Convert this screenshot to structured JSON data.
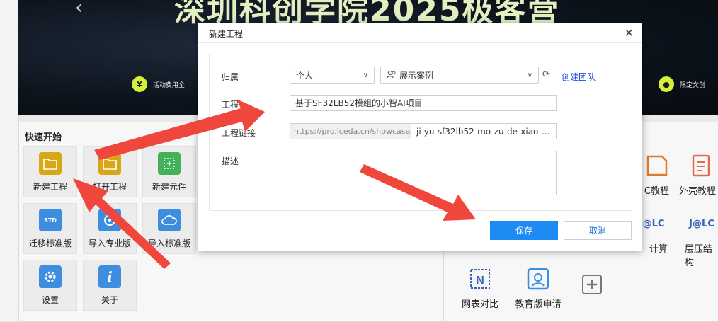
{
  "banner": {
    "title": "深圳科创学院2025极客营",
    "pill_left": "活动费用全",
    "pill_right": "限定文创"
  },
  "quick_start": {
    "title": "快速开始",
    "tiles": [
      {
        "label": "新建工程",
        "icon": "new-project-folder-icon",
        "color": "#d9a715"
      },
      {
        "label": "打开工程",
        "icon": "open-project-folder-icon",
        "color": "#d9a715"
      },
      {
        "label": "新建元件",
        "icon": "new-component-icon",
        "color": "#43b15a"
      },
      {
        "label": "迁移标准版",
        "icon": "migrate-std-icon",
        "color": "#3e8ee0"
      },
      {
        "label": "导入专业版",
        "icon": "import-pro-icon",
        "color": "#3e8ee0"
      },
      {
        "label": "导入标准版",
        "icon": "import-std-icon",
        "color": "#3e8ee0"
      },
      {
        "label": "设置",
        "icon": "settings-gear-icon",
        "color": "#3e8ee0"
      },
      {
        "label": "关于",
        "icon": "info-icon",
        "color": "#3e8ee0"
      }
    ]
  },
  "right_panel": {
    "tiles": [
      {
        "label": "C教程",
        "icon": "fpc-tutorial-icon"
      },
      {
        "label": "外壳教程",
        "icon": "enclosure-tutorial-icon"
      },
      {
        "label": "计算",
        "icon": "jlc-calculator-icon"
      },
      {
        "label": "层压结构",
        "icon": "jlc-stackup-icon"
      },
      {
        "label": "网表对比",
        "icon": "netlist-compare-icon"
      },
      {
        "label": "教育版申请",
        "icon": "education-apply-icon"
      },
      {
        "label": "",
        "icon": "add-plus-icon"
      }
    ]
  },
  "dialog": {
    "title": "新建工程",
    "belong_label": "归属",
    "owner_value": "个人",
    "team_value": "展示案例",
    "create_team_link": "创建团队",
    "project_label": "工程",
    "project_value": "基于SF32LB52模组的小智AI项目",
    "link_label": "工程链接",
    "link_prefix": "https://pro.lceda.cn/showcase/",
    "link_slug": "ji-yu-sf32lb52-mo-zu-de-xiao-...",
    "desc_label": "描述",
    "desc_value": "",
    "save_button": "保存",
    "cancel_button": "取消"
  },
  "colors": {
    "primary": "#1d8bf3",
    "link": "#1a4fd8",
    "annotation_arrow": "#f0473d",
    "banner_accent": "#d6ef38"
  }
}
